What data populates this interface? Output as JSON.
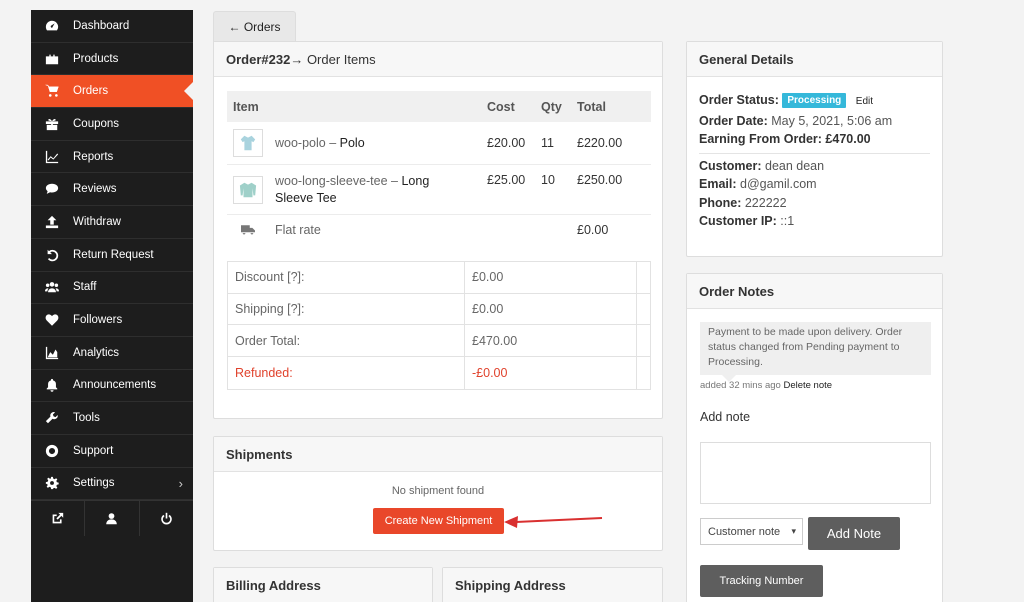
{
  "sidebar": {
    "items": [
      {
        "label": "Dashboard",
        "icon": "dashboard-icon"
      },
      {
        "label": "Products",
        "icon": "briefcase-icon"
      },
      {
        "label": "Orders",
        "icon": "cart-icon",
        "active": true
      },
      {
        "label": "Coupons",
        "icon": "gift-icon"
      },
      {
        "label": "Reports",
        "icon": "line-chart-icon"
      },
      {
        "label": "Reviews",
        "icon": "comments-icon"
      },
      {
        "label": "Withdraw",
        "icon": "upload-icon"
      },
      {
        "label": "Return Request",
        "icon": "undo-icon"
      },
      {
        "label": "Staff",
        "icon": "users-icon"
      },
      {
        "label": "Followers",
        "icon": "heart-icon"
      },
      {
        "label": "Analytics",
        "icon": "area-chart-icon"
      },
      {
        "label": "Announcements",
        "icon": "bell-icon"
      },
      {
        "label": "Tools",
        "icon": "wrench-icon"
      },
      {
        "label": "Support",
        "icon": "lifebuoy-icon"
      },
      {
        "label": "Settings",
        "icon": "gear-icon"
      }
    ],
    "footer": [
      "external-link-icon",
      "user-icon",
      "power-icon"
    ],
    "active_color": "#f05025"
  },
  "back_button": {
    "label": "← Orders"
  },
  "order": {
    "number": "Order#232",
    "crumb": " → Order Items",
    "columns": {
      "item": "Item",
      "cost": "Cost",
      "qty": "Qty",
      "total": "Total"
    },
    "items": [
      {
        "sku": "woo-polo",
        "sep": " – ",
        "name": "Polo",
        "cost": "£20.00",
        "qty": "11",
        "total": "£220.00"
      },
      {
        "sku": "woo-long-sleeve-tee",
        "sep": " – ",
        "name": "Long Sleeve Tee",
        "cost": "£25.00",
        "qty": "10",
        "total": "£250.00"
      }
    ],
    "shipping_line": {
      "label": "Flat rate",
      "total": "£0.00"
    },
    "totals": [
      {
        "label": "Discount [?]:",
        "value": "£0.00"
      },
      {
        "label": "Shipping [?]:",
        "value": "£0.00"
      },
      {
        "label": "Order Total:",
        "value": "£470.00"
      },
      {
        "label": "Refunded:",
        "value": "-£0.00"
      }
    ]
  },
  "shipments": {
    "title": "Shipments",
    "empty_text": "No shipment found",
    "create_label": "Create New Shipment"
  },
  "billing": {
    "title": "Billing Address"
  },
  "shipping_address": {
    "title": "Shipping Address"
  },
  "general": {
    "title": "General Details",
    "status_label": "Order Status:",
    "status_value": "Processing",
    "status_color": "#35b8da",
    "edit_label": "Edit",
    "date_label": "Order Date:",
    "date_value": "May 5, 2021, 5:06 am",
    "earning_label": "Earning From Order:",
    "earning_value": "£470.00",
    "customer_label": "Customer:",
    "customer_value": "dean dean",
    "email_label": "Email:",
    "email_value": "d@gamil.com",
    "phone_label": "Phone:",
    "phone_value": "222222",
    "ip_label": "Customer IP:",
    "ip_value": "::1"
  },
  "notes": {
    "title": "Order Notes",
    "note_text": "Payment to be made upon delivery. Order status changed from Pending payment to Processing.",
    "meta_prefix": "added 32 mins ago",
    "delete_label": "Delete note",
    "add_label": "Add note",
    "note_type": "Customer note",
    "add_button": "Add Note",
    "tracking_button": "Tracking Number"
  }
}
